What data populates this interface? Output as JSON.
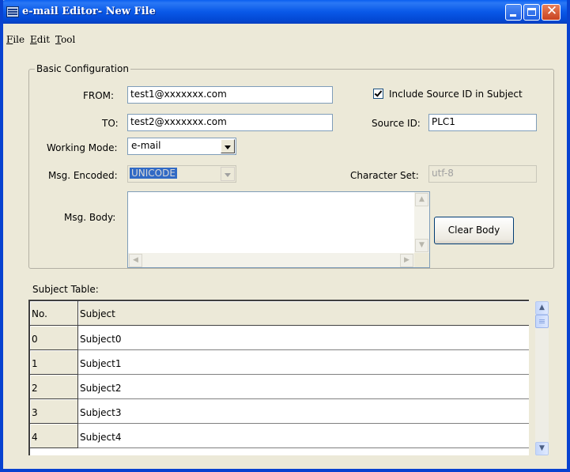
{
  "window": {
    "title": "e-mail Editor- New File"
  },
  "menu": [
    {
      "accel": "F",
      "rest": "ile"
    },
    {
      "accel": "E",
      "rest": "dit"
    },
    {
      "accel": "T",
      "rest": "ool"
    }
  ],
  "config": {
    "group_title": "Basic Configuration",
    "from_label": "FROM:",
    "from_value": "test1@xxxxxxx.com",
    "to_label": "TO:",
    "to_value": "test2@xxxxxxx.com",
    "include_source_label": "Include Source ID in Subject",
    "include_source_checked": true,
    "source_id_label": "Source ID:",
    "source_id_value": "PLC1",
    "working_mode_label": "Working Mode:",
    "working_mode_value": "e-mail",
    "msg_encoded_label": "Msg. Encoded:",
    "msg_encoded_value": "UNICODE",
    "charset_label": "Character Set:",
    "charset_value": "utf-8",
    "msg_body_label": "Msg. Body:",
    "msg_body_value": "",
    "clear_body_label": "Clear Body"
  },
  "subject_table": {
    "title": "Subject Table:",
    "columns": [
      "No.",
      "Subject"
    ],
    "rows": [
      {
        "no": "0",
        "subject": "Subject0"
      },
      {
        "no": "1",
        "subject": "Subject1"
      },
      {
        "no": "2",
        "subject": "Subject2"
      },
      {
        "no": "3",
        "subject": "Subject3"
      },
      {
        "no": "4",
        "subject": "Subject4"
      }
    ]
  },
  "colors": {
    "title_bar": "#0a5ff0",
    "window_bg": "#ece9d8",
    "selection": "#316ac5"
  }
}
